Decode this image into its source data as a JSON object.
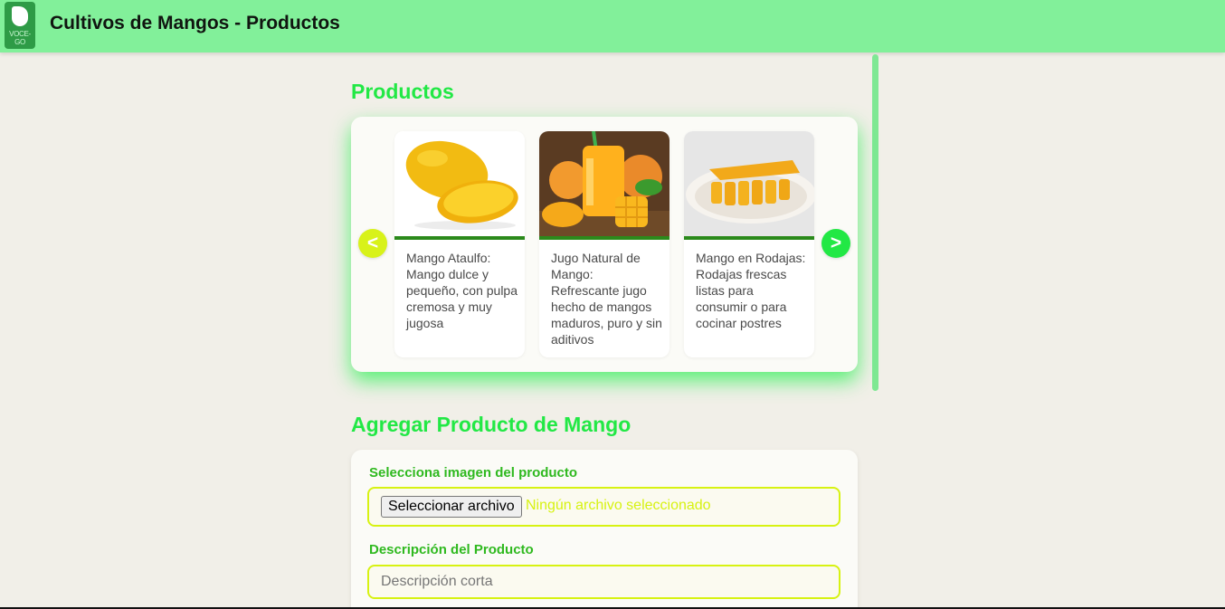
{
  "header": {
    "title": "Cultivos de Mangos - Productos",
    "logo_text": "VOCE-GO",
    "background": "#82f09a"
  },
  "products_section": {
    "title": "Productos",
    "prev_label": "<",
    "next_label": ">",
    "items": [
      {
        "description": "Mango Ataulfo: Mango dulce y pequeño, con pulpa cremosa y muy jugosa",
        "image": "mango-ataulfo-photo"
      },
      {
        "description": "Jugo Natural de Mango: Refrescante jugo hecho de mangos maduros, puro y sin aditivos",
        "image": "mango-juice-photo"
      },
      {
        "description": "Mango en Rodajas: Rodajas frescas listas para consumir o para cocinar postres",
        "image": "mango-slices-photo"
      }
    ]
  },
  "add_section": {
    "title": "Agregar Producto de Mango",
    "image_label": "Selecciona imagen del producto",
    "file_button": "Seleccionar archivo",
    "file_status": "Ningún archivo seleccionado",
    "description_label": "Descripción del Producto",
    "description_placeholder": "Descripción corta",
    "description_value": ""
  },
  "colors": {
    "accent_green": "#22e845",
    "label_green": "#2fb91f",
    "lime": "#d7f212",
    "card_bar": "#2b8a1b",
    "page_background": "#f1efe8"
  }
}
